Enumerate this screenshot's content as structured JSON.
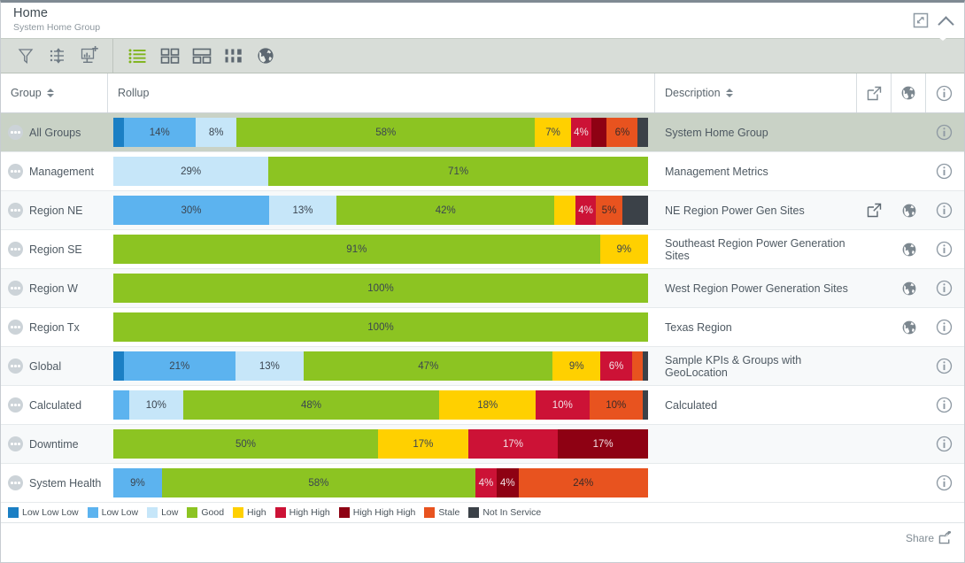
{
  "header": {
    "title": "Home",
    "subtitle": "System Home Group",
    "expand_icon": "expand-icon",
    "collapse_icon": "chevron-up-icon"
  },
  "toolbar": {
    "groups": [
      {
        "buttons": [
          {
            "name": "filter-icon",
            "tooltip": "Filter"
          },
          {
            "name": "sort-icon",
            "tooltip": "Sort"
          },
          {
            "name": "add-chart-icon",
            "tooltip": "Add Display"
          }
        ]
      },
      {
        "buttons": [
          {
            "name": "list-view-icon",
            "tooltip": "List View",
            "active": true
          },
          {
            "name": "grid-view-icon",
            "tooltip": "Grid View",
            "active": false
          },
          {
            "name": "panel-view-icon",
            "tooltip": "Panel View",
            "active": false
          },
          {
            "name": "column-view-icon",
            "tooltip": "Column View",
            "active": false
          },
          {
            "name": "globe-view-icon",
            "tooltip": "Map View",
            "active": false
          }
        ]
      }
    ]
  },
  "columns": {
    "group": "Group",
    "rollup": "Rollup",
    "description": "Description",
    "link_icon": "external-link-icon",
    "globe_icon": "globe-icon",
    "info_icon": "info-icon"
  },
  "legend": [
    {
      "label": "Low Low Low",
      "color": "#1b7fc4"
    },
    {
      "label": "Low Low",
      "color": "#5cb3ef"
    },
    {
      "label": "Low",
      "color": "#c6e6f9"
    },
    {
      "label": "Good",
      "color": "#8cc422"
    },
    {
      "label": "High",
      "color": "#ffd000"
    },
    {
      "label": "High High",
      "color": "#cc1236"
    },
    {
      "label": "High High High",
      "color": "#8e0113"
    },
    {
      "label": "Stale",
      "color": "#e8531f"
    },
    {
      "label": "Not In Service",
      "color": "#3b4148"
    }
  ],
  "footer": {
    "share_label": "Share",
    "share_icon": "share-icon"
  },
  "rows": [
    {
      "group": "All Groups",
      "description": "System Home Group",
      "selected": true,
      "has_link": false,
      "has_globe": false,
      "has_info": true,
      "segments": [
        {
          "state": "Low Low Low",
          "color": "#1b7fc4",
          "pct": 2,
          "label": ""
        },
        {
          "state": "Low Low",
          "color": "#5cb3ef",
          "pct": 14,
          "label": "14%",
          "text": "#3b4550"
        },
        {
          "state": "Low",
          "color": "#c6e6f9",
          "pct": 8,
          "label": "8%",
          "text": "#3b4550"
        },
        {
          "state": "Good",
          "color": "#8cc422",
          "pct": 58,
          "label": "58%",
          "text": "#3b4550"
        },
        {
          "state": "High",
          "color": "#ffd000",
          "pct": 7,
          "label": "7%",
          "text": "#3b4550"
        },
        {
          "state": "High High",
          "color": "#cc1236",
          "pct": 4,
          "label": "4%",
          "text": "#f2e2e6"
        },
        {
          "state": "High High High",
          "color": "#8e0113",
          "pct": 3,
          "label": "",
          "text": "#f2e2e6"
        },
        {
          "state": "Stale",
          "color": "#e8531f",
          "pct": 6,
          "label": "6%",
          "text": "#3b2b28"
        },
        {
          "state": "Not In Service",
          "color": "#3b4148",
          "pct": 2,
          "label": ""
        }
      ]
    },
    {
      "group": "Management",
      "description": "Management Metrics",
      "selected": false,
      "has_link": false,
      "has_globe": false,
      "has_info": true,
      "segments": [
        {
          "state": "Low",
          "color": "#c6e6f9",
          "pct": 29,
          "label": "29%",
          "text": "#3b4550"
        },
        {
          "state": "Good",
          "color": "#8cc422",
          "pct": 71,
          "label": "71%",
          "text": "#3b4550"
        }
      ]
    },
    {
      "group": "Region NE",
      "description": "NE Region Power Gen Sites",
      "selected": false,
      "has_link": true,
      "has_globe": true,
      "has_info": true,
      "segments": [
        {
          "state": "Low Low",
          "color": "#5cb3ef",
          "pct": 30,
          "label": "30%",
          "text": "#3b4550"
        },
        {
          "state": "Low",
          "color": "#c6e6f9",
          "pct": 13,
          "label": "13%",
          "text": "#3b4550"
        },
        {
          "state": "Good",
          "color": "#8cc422",
          "pct": 42,
          "label": "42%",
          "text": "#3b4550"
        },
        {
          "state": "High",
          "color": "#ffd000",
          "pct": 4,
          "label": "",
          "text": "#3b4550"
        },
        {
          "state": "High High",
          "color": "#cc1236",
          "pct": 4,
          "label": "4%",
          "text": "#f2e2e6"
        },
        {
          "state": "Stale",
          "color": "#e8531f",
          "pct": 5,
          "label": "5%",
          "text": "#3b2b28"
        },
        {
          "state": "Not In Service",
          "color": "#3b4148",
          "pct": 5,
          "label": ""
        }
      ]
    },
    {
      "group": "Region SE",
      "description": "Southeast Region Power Generation Sites",
      "selected": false,
      "has_link": false,
      "has_globe": true,
      "has_info": true,
      "segments": [
        {
          "state": "Good",
          "color": "#8cc422",
          "pct": 91,
          "label": "91%",
          "text": "#3b4550"
        },
        {
          "state": "High",
          "color": "#ffd000",
          "pct": 9,
          "label": "9%",
          "text": "#3b4550"
        }
      ]
    },
    {
      "group": "Region W",
      "description": "West Region Power Generation Sites",
      "selected": false,
      "has_link": false,
      "has_globe": true,
      "has_info": true,
      "segments": [
        {
          "state": "Good",
          "color": "#8cc422",
          "pct": 100,
          "label": "100%",
          "text": "#3b4550"
        }
      ]
    },
    {
      "group": "Region Tx",
      "description": "Texas Region",
      "selected": false,
      "has_link": false,
      "has_globe": true,
      "has_info": true,
      "segments": [
        {
          "state": "Good",
          "color": "#8cc422",
          "pct": 100,
          "label": "100%",
          "text": "#3b4550"
        }
      ]
    },
    {
      "group": "Global",
      "description": "Sample KPIs & Groups with GeoLocation",
      "selected": false,
      "has_link": false,
      "has_globe": false,
      "has_info": true,
      "segments": [
        {
          "state": "Low Low Low",
          "color": "#1b7fc4",
          "pct": 2,
          "label": ""
        },
        {
          "state": "Low Low",
          "color": "#5cb3ef",
          "pct": 21,
          "label": "21%",
          "text": "#3b4550"
        },
        {
          "state": "Low",
          "color": "#c6e6f9",
          "pct": 13,
          "label": "13%",
          "text": "#3b4550"
        },
        {
          "state": "Good",
          "color": "#8cc422",
          "pct": 47,
          "label": "47%",
          "text": "#3b4550"
        },
        {
          "state": "High",
          "color": "#ffd000",
          "pct": 9,
          "label": "9%",
          "text": "#3b4550"
        },
        {
          "state": "High High",
          "color": "#cc1236",
          "pct": 6,
          "label": "6%",
          "text": "#f2e2e6"
        },
        {
          "state": "Stale",
          "color": "#e8531f",
          "pct": 2,
          "label": ""
        },
        {
          "state": "Not In Service",
          "color": "#3b4148",
          "pct": 1,
          "label": ""
        }
      ]
    },
    {
      "group": "Calculated",
      "description": "Calculated",
      "selected": false,
      "has_link": false,
      "has_globe": false,
      "has_info": true,
      "segments": [
        {
          "state": "Low Low",
          "color": "#5cb3ef",
          "pct": 3,
          "label": ""
        },
        {
          "state": "Low",
          "color": "#c6e6f9",
          "pct": 10,
          "label": "10%",
          "text": "#3b4550"
        },
        {
          "state": "Good",
          "color": "#8cc422",
          "pct": 48,
          "label": "48%",
          "text": "#3b4550"
        },
        {
          "state": "High",
          "color": "#ffd000",
          "pct": 18,
          "label": "18%",
          "text": "#3b4550"
        },
        {
          "state": "High High",
          "color": "#cc1236",
          "pct": 10,
          "label": "10%",
          "text": "#f2e2e6"
        },
        {
          "state": "Stale",
          "color": "#e8531f",
          "pct": 10,
          "label": "10%",
          "text": "#3b2b28"
        },
        {
          "state": "Not In Service",
          "color": "#3b4148",
          "pct": 1,
          "label": ""
        }
      ]
    },
    {
      "group": "Downtime",
      "description": "",
      "selected": false,
      "has_link": false,
      "has_globe": false,
      "has_info": true,
      "segments": [
        {
          "state": "Good",
          "color": "#8cc422",
          "pct": 50,
          "label": "50%",
          "text": "#3b4550"
        },
        {
          "state": "High",
          "color": "#ffd000",
          "pct": 17,
          "label": "17%",
          "text": "#3b4550"
        },
        {
          "state": "High High",
          "color": "#cc1236",
          "pct": 17,
          "label": "17%",
          "text": "#f2e2e6"
        },
        {
          "state": "High High High",
          "color": "#8e0113",
          "pct": 17,
          "label": "17%",
          "text": "#f2e2e6"
        }
      ]
    },
    {
      "group": "System Health",
      "description": "",
      "selected": false,
      "has_link": false,
      "has_globe": false,
      "has_info": true,
      "segments": [
        {
          "state": "Low Low",
          "color": "#5cb3ef",
          "pct": 9,
          "label": "9%",
          "text": "#3b4550"
        },
        {
          "state": "Good",
          "color": "#8cc422",
          "pct": 58,
          "label": "58%",
          "text": "#3b4550"
        },
        {
          "state": "High High",
          "color": "#cc1236",
          "pct": 4,
          "label": "4%",
          "text": "#f2e2e6"
        },
        {
          "state": "High High High",
          "color": "#8e0113",
          "pct": 4,
          "label": "4%",
          "text": "#f2e2e6"
        },
        {
          "state": "Stale",
          "color": "#e8531f",
          "pct": 24,
          "label": "24%",
          "text": "#3b2b28"
        }
      ]
    }
  ]
}
